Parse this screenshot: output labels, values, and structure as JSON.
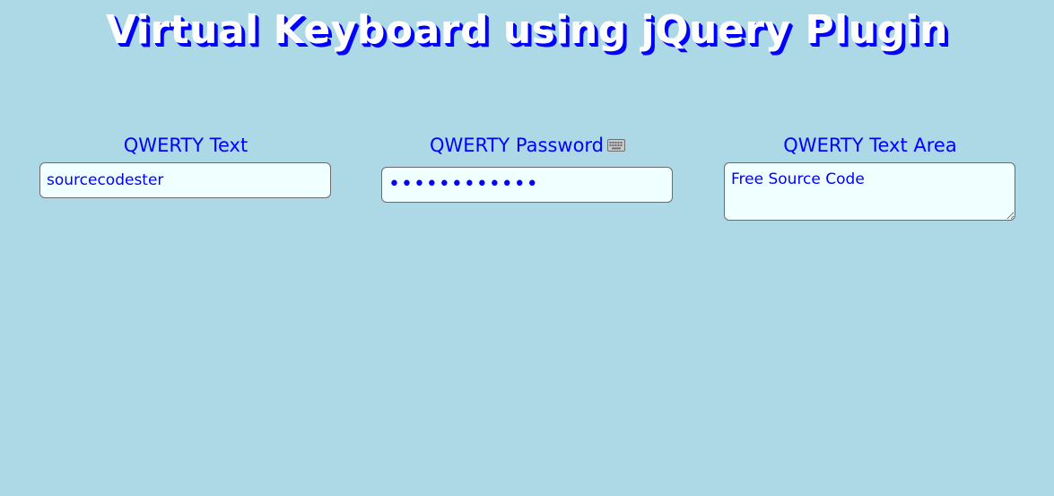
{
  "page": {
    "title": "Virtual Keyboard using jQuery Plugin"
  },
  "fields": [
    {
      "label": "QWERTY Text",
      "value": "sourcecodester",
      "type": "text"
    },
    {
      "label": "QWERTY Password",
      "value": "••••••••••••",
      "type": "password",
      "icon": "keyboard-icon"
    },
    {
      "label": "QWERTY Text Area",
      "value": "Free Source Code",
      "type": "textarea"
    }
  ],
  "colors": {
    "background": "#add8e6",
    "label": "#0000ff",
    "title_fill": "#ffffff",
    "title_shadow": "#0000ff",
    "field_background": "#f0ffff"
  }
}
